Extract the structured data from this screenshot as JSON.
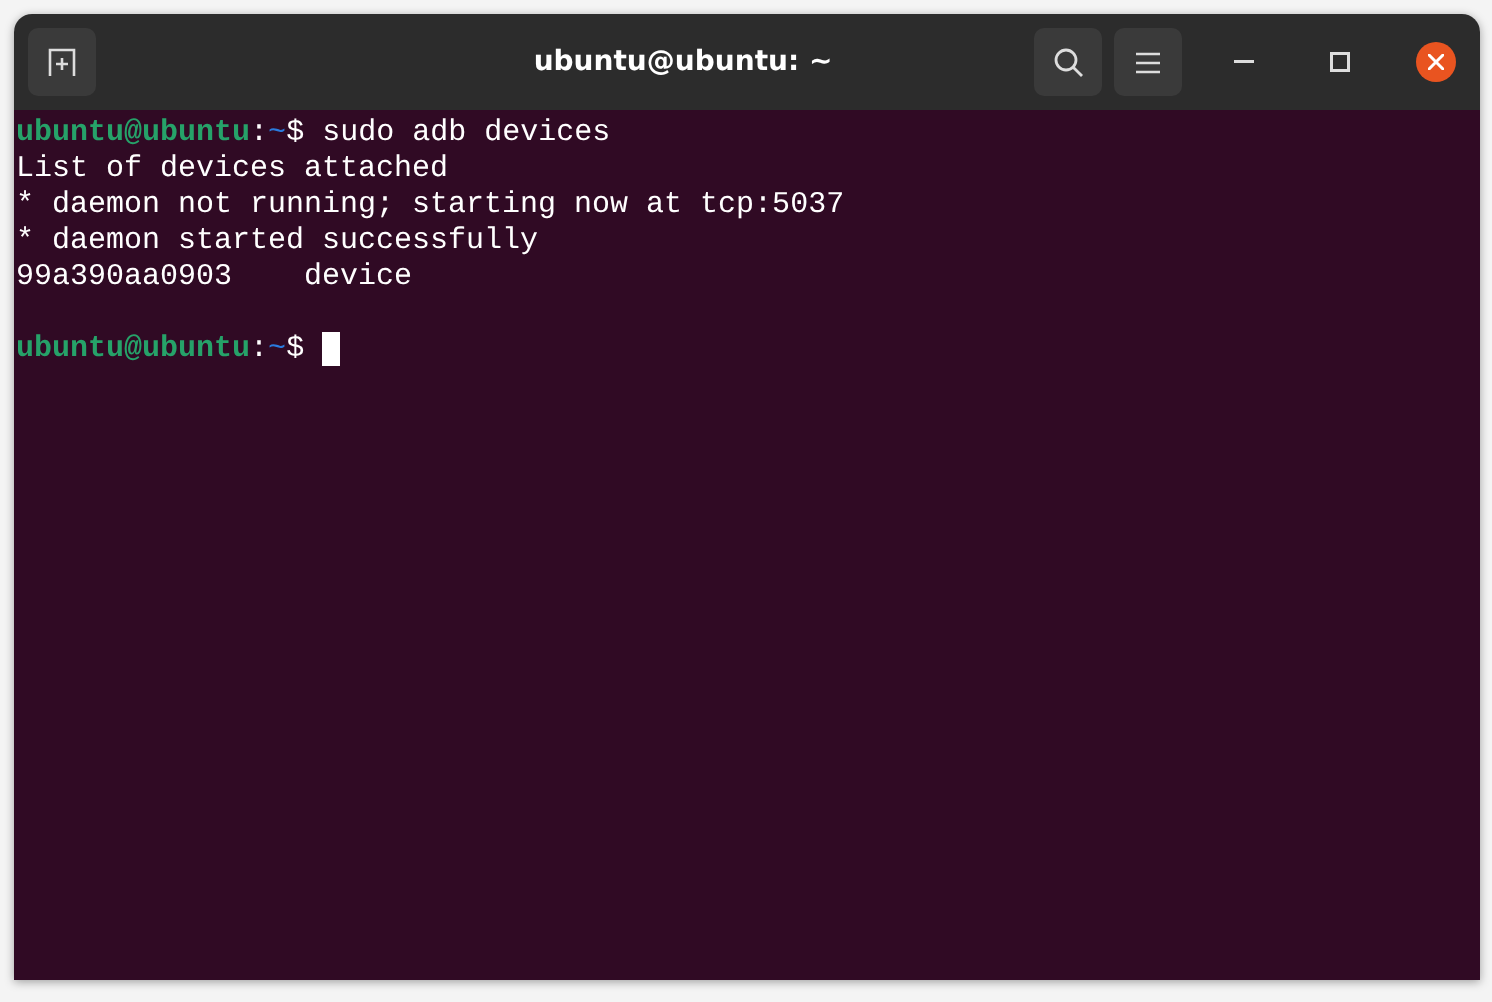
{
  "window": {
    "title": "ubuntu@ubuntu: ~"
  },
  "terminal": {
    "lines": [
      {
        "kind": "prompt",
        "user_host": "ubuntu@ubuntu",
        "separator": ":",
        "path": "~",
        "symbol": "$",
        "command": "sudo adb devices",
        "cursor": false
      },
      {
        "kind": "output",
        "text": "List of devices attached"
      },
      {
        "kind": "output",
        "text": "* daemon not running; starting now at tcp:5037"
      },
      {
        "kind": "output",
        "text": "* daemon started successfully"
      },
      {
        "kind": "output",
        "text": "99a390aa0903    device"
      },
      {
        "kind": "blank"
      },
      {
        "kind": "prompt",
        "user_host": "ubuntu@ubuntu",
        "separator": ":",
        "path": "~",
        "symbol": "$",
        "cursor": true
      }
    ]
  }
}
